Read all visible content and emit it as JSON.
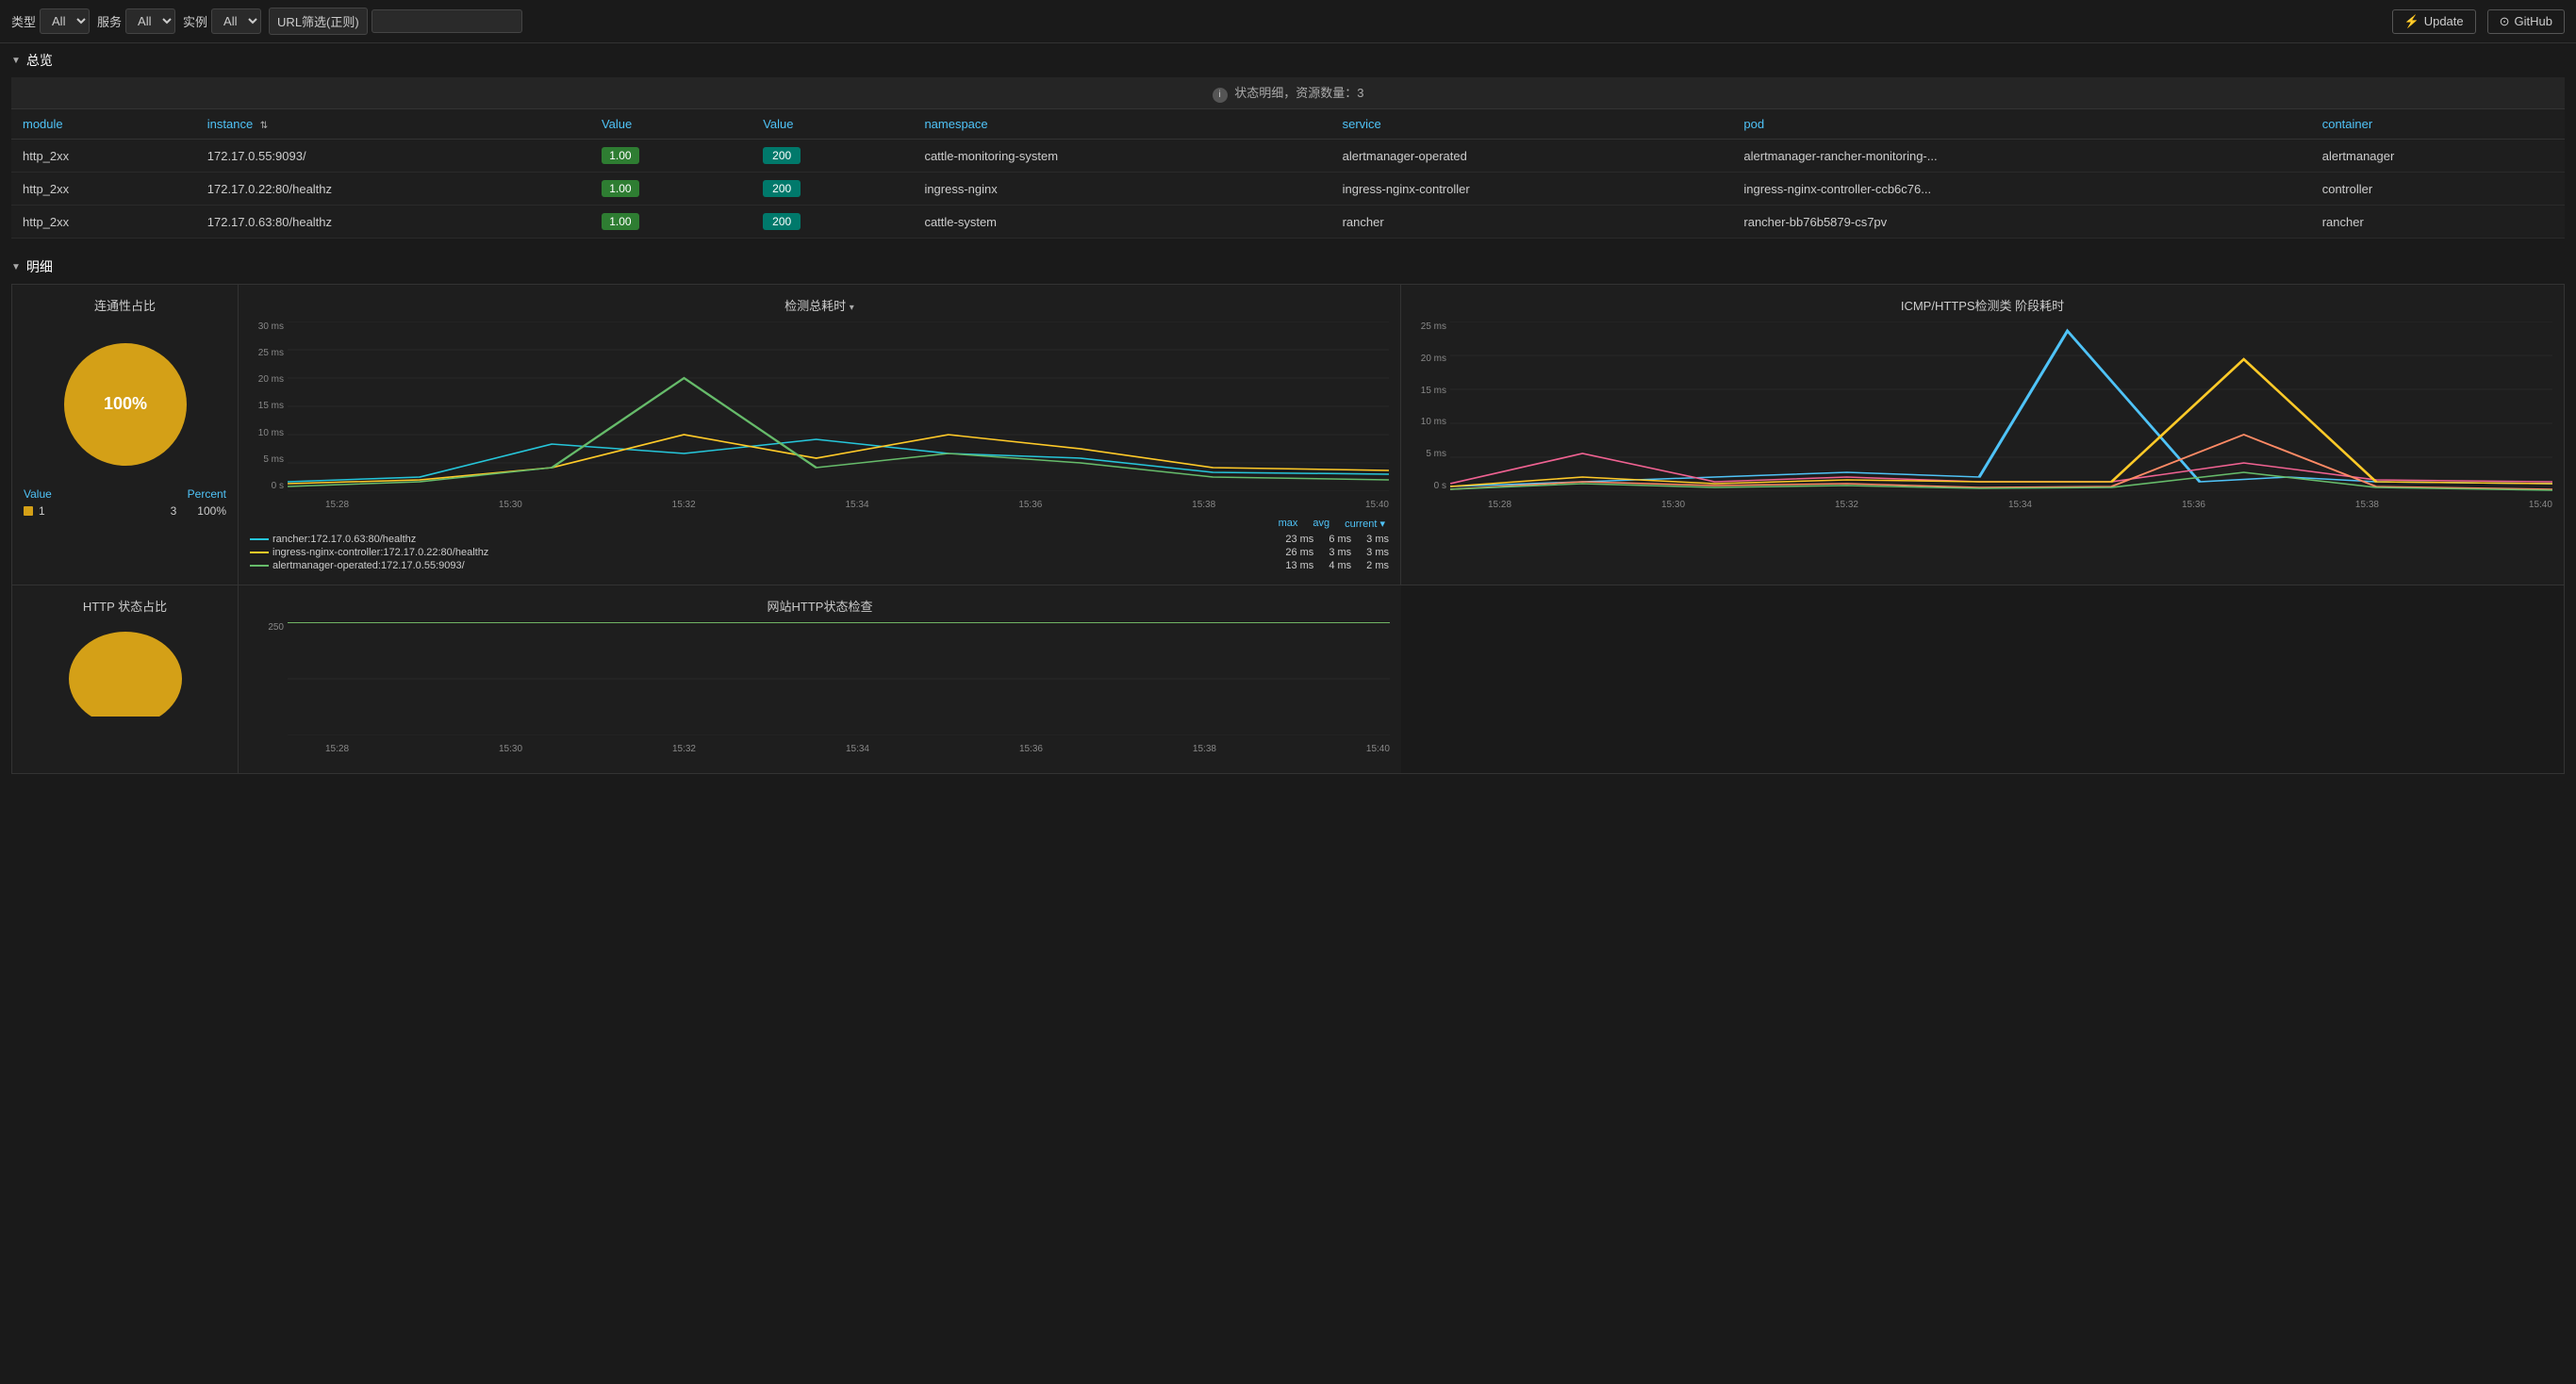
{
  "topbar": {
    "type_label": "类型",
    "type_value": "All",
    "service_label": "服务",
    "service_value": "All",
    "instance_label": "实例",
    "instance_value": "All",
    "url_filter_label": "URL筛选(正则)",
    "url_filter_placeholder": "",
    "update_btn": "Update",
    "github_btn": "GitHub"
  },
  "overview": {
    "section_label": "总览",
    "status_bar": "状态明细，资源数量：3",
    "columns": [
      "module",
      "instance",
      "Value",
      "Value",
      "namespace",
      "service",
      "pod",
      "container"
    ],
    "rows": [
      {
        "module": "http_2xx",
        "instance": "172.17.0.55:9093/",
        "value1": "1.00",
        "value2": "200",
        "namespace": "cattle-monitoring-system",
        "service": "alertmanager-operated",
        "pod": "alertmanager-rancher-monitoring-...",
        "container": "alertmanager"
      },
      {
        "module": "http_2xx",
        "instance": "172.17.0.22:80/healthz",
        "value1": "1.00",
        "value2": "200",
        "namespace": "ingress-nginx",
        "service": "ingress-nginx-controller",
        "pod": "ingress-nginx-controller-ccb6c76...",
        "container": "controller"
      },
      {
        "module": "http_2xx",
        "instance": "172.17.0.63:80/healthz",
        "value1": "1.00",
        "value2": "200",
        "namespace": "cattle-system",
        "service": "rancher",
        "pod": "rancher-bb76b5879-cs7pv",
        "container": "rancher"
      }
    ]
  },
  "detail": {
    "section_label": "明细"
  },
  "connectivity_pie": {
    "title": "连通性占比",
    "value_header": "Value",
    "percent_header": "Percent",
    "rows": [
      {
        "color": "#d4a017",
        "value": "1",
        "count": "3",
        "percent": "100%"
      }
    ],
    "center_label": "100%"
  },
  "http_status_pie": {
    "title": "HTTP 状态占比"
  },
  "detection_chart": {
    "title": "检测总耗时",
    "y_labels": [
      "30 ms",
      "25 ms",
      "20 ms",
      "15 ms",
      "10 ms",
      "5 ms",
      "0 s"
    ],
    "x_labels": [
      "15:28",
      "15:30",
      "15:32",
      "15:34",
      "15:36",
      "15:38",
      "15:40"
    ],
    "legend_headers": [
      "max",
      "avg",
      "current"
    ],
    "legend_rows": [
      {
        "color": "#26c6da",
        "label": "rancher:172.17.0.63:80/healthz",
        "max": "23 ms",
        "avg": "6 ms",
        "current": "3 ms"
      },
      {
        "color": "#ffca28",
        "label": "ingress-nginx-controller:172.17.0.22:80/healthz",
        "max": "26 ms",
        "avg": "3 ms",
        "current": "3 ms"
      },
      {
        "color": "#66bb6a",
        "label": "alertmanager-operated:172.17.0.55:9093/",
        "max": "13 ms",
        "avg": "4 ms",
        "current": "2 ms"
      }
    ]
  },
  "icmp_chart": {
    "title": "ICMP/HTTPS检测类 阶段耗时",
    "y_labels": [
      "25 ms",
      "20 ms",
      "15 ms",
      "10 ms",
      "5 ms",
      "0 s"
    ],
    "x_labels": [
      "15:28",
      "15:30",
      "15:32",
      "15:34",
      "15:36",
      "15:38",
      "15:40"
    ]
  },
  "http_status_chart": {
    "title": "网站HTTP状态检查",
    "y_labels": [
      "250"
    ]
  }
}
